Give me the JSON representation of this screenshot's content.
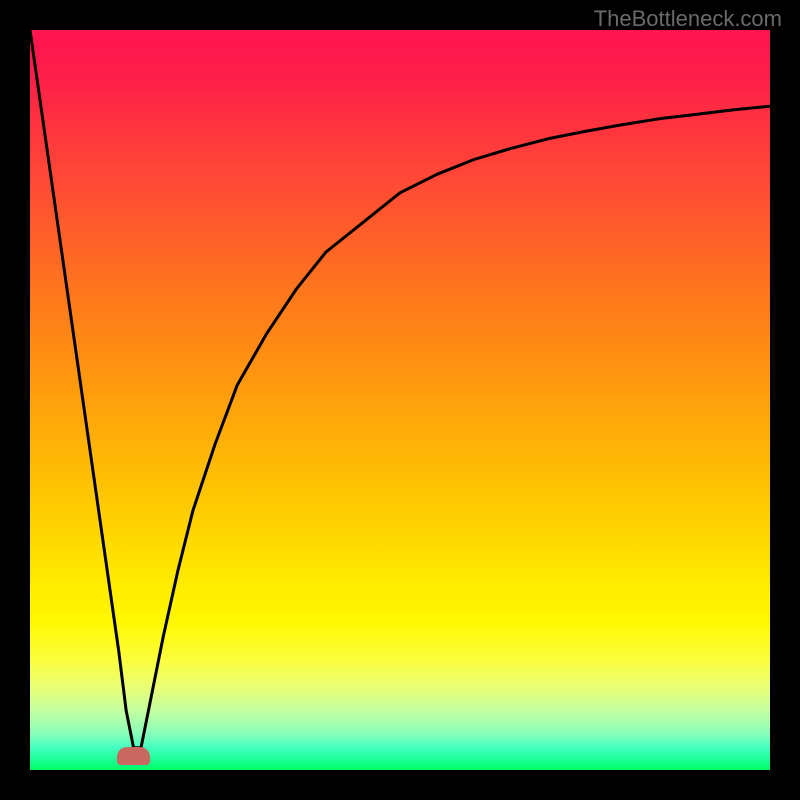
{
  "watermark": "TheBottleneck.com",
  "chart_data": {
    "type": "line",
    "title": "",
    "xlabel": "",
    "ylabel": "",
    "xlim": [
      0,
      100
    ],
    "ylim": [
      0,
      100
    ],
    "grid": false,
    "gradient": {
      "top_color": "#ff1450",
      "bottom_color": "#00ff66",
      "description": "vertical gradient red (high) to green (low) representing bottleneck severity"
    },
    "series": [
      {
        "name": "bottleneck-curve",
        "description": "V-shaped curve: steep linear descent to minimum near x=14, then logarithmic-like ascent flattening toward top-right",
        "x": [
          0,
          2,
          4,
          6,
          8,
          10,
          12,
          13,
          14,
          15,
          16,
          18,
          20,
          22,
          25,
          28,
          32,
          36,
          40,
          45,
          50,
          55,
          60,
          65,
          70,
          75,
          80,
          85,
          90,
          95,
          100
        ],
        "y": [
          100,
          86,
          72,
          58,
          44,
          30,
          16,
          8,
          3,
          3,
          8,
          18,
          27,
          35,
          44,
          52,
          59,
          65,
          70,
          74,
          78,
          80.5,
          82.5,
          84,
          85.3,
          86.3,
          87.2,
          88,
          88.6,
          89.2,
          89.7
        ]
      }
    ],
    "marker": {
      "description": "optimal point marker at curve minimum",
      "x_center": 14,
      "y_value": 2,
      "width_pct": 4.5,
      "color": "#c96860"
    },
    "plot_dimensions": {
      "outer_width": 800,
      "outer_height": 800,
      "inner_width": 740,
      "inner_height": 740,
      "margin": 30
    }
  }
}
